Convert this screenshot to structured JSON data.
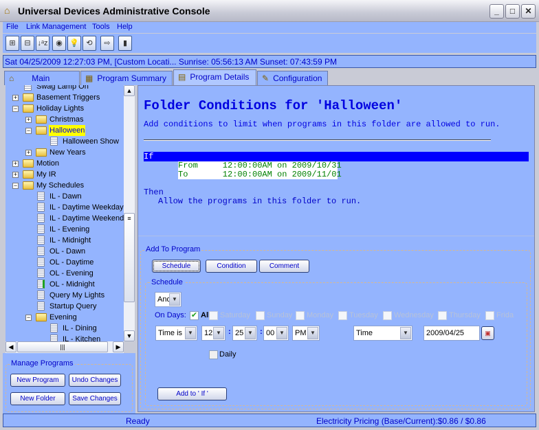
{
  "window": {
    "title": "Universal Devices Administrative Console",
    "minimize": "_",
    "maximize": "□",
    "close": "✕"
  },
  "menu": [
    "File",
    "Link Management",
    "Tools",
    "Help"
  ],
  "toolbar": [
    {
      "icon": "expand-all-icon",
      "glyph": "⊞"
    },
    {
      "icon": "collapse-all-icon",
      "glyph": "⊟"
    },
    {
      "icon": "sort-az-icon",
      "glyph": "↓ᵃz"
    },
    {
      "icon": "devices-icon",
      "glyph": "◉"
    },
    {
      "icon": "lightbulb-icon",
      "glyph": "💡"
    },
    {
      "icon": "refresh-icon",
      "glyph": "⟲"
    },
    {
      "icon": "export-icon",
      "glyph": "⇨"
    },
    {
      "icon": "chart-icon",
      "glyph": "▮"
    }
  ],
  "dateline": "Sat 04/25/2009 12:27:03 PM,  [Custom Locati... Sunrise: 05:56:13 AM   Sunset: 07:43:59 PM",
  "tabs": [
    {
      "label": "Main",
      "icon": "home-icon"
    },
    {
      "label": "Program Summary",
      "icon": "table-icon"
    },
    {
      "label": "Program Details",
      "icon": "document-icon",
      "active": true
    },
    {
      "label": "Configuration",
      "icon": "wrench-icon"
    }
  ],
  "tree": [
    {
      "label": "Swag Lamp On",
      "level": 0,
      "type": "program"
    },
    {
      "label": "Basement Triggers",
      "level": 0,
      "type": "folder",
      "toggle": "+"
    },
    {
      "label": "Holiday Lights",
      "level": 0,
      "type": "folder",
      "toggle": "-"
    },
    {
      "label": "Christmas",
      "level": 1,
      "type": "folder",
      "toggle": "+"
    },
    {
      "label": "Halloween",
      "level": 1,
      "type": "folder",
      "toggle": "-",
      "selected": true
    },
    {
      "label": "Halloween Show",
      "level": 2,
      "type": "program"
    },
    {
      "label": "New Years",
      "level": 1,
      "type": "folder",
      "toggle": "+"
    },
    {
      "label": "Motion",
      "level": 0,
      "type": "folder",
      "toggle": "+"
    },
    {
      "label": "My IR",
      "level": 0,
      "type": "folder",
      "toggle": "+"
    },
    {
      "label": "My Schedules",
      "level": 0,
      "type": "folder",
      "toggle": "-"
    },
    {
      "label": "IL - Dawn",
      "level": 1,
      "type": "program"
    },
    {
      "label": "IL - Daytime Weekdays",
      "level": 1,
      "type": "program"
    },
    {
      "label": "IL - Daytime Weekends",
      "level": 1,
      "type": "program"
    },
    {
      "label": "IL - Evening",
      "level": 1,
      "type": "program"
    },
    {
      "label": "IL - Midnight",
      "level": 1,
      "type": "program"
    },
    {
      "label": "OL - Dawn",
      "level": 1,
      "type": "program"
    },
    {
      "label": "OL - Daytime",
      "level": 1,
      "type": "program"
    },
    {
      "label": "OL - Evening",
      "level": 1,
      "type": "program"
    },
    {
      "label": "OL - Midnight",
      "level": 1,
      "type": "program",
      "running": true
    },
    {
      "label": "Query My Lights",
      "level": 1,
      "type": "program"
    },
    {
      "label": "Startup Query",
      "level": 1,
      "type": "program"
    },
    {
      "label": "Evening",
      "level": 1,
      "type": "folder",
      "toggle": "-"
    },
    {
      "label": "IL - Dining",
      "level": 2,
      "type": "program"
    },
    {
      "label": "IL - Kitchen",
      "level": 2,
      "type": "program"
    }
  ],
  "manage": {
    "title": "Manage Programs",
    "new_program": "New Program",
    "undo": "Undo Changes",
    "new_folder": "New Folder",
    "save": "Save Changes"
  },
  "details": {
    "heading": "Folder Conditions for 'Halloween'",
    "subtitle": "Add conditions to limit when programs in this folder are allowed to run.",
    "if": "If",
    "from": "From     12:00:00AM on 2009/10/31",
    "to": "To       12:00:00AM on 2009/11/01",
    "then": "Then",
    "then_action": "Allow the programs in this folder to run."
  },
  "add": {
    "title": "Add To Program",
    "schedule_btn": "Schedule",
    "condition_btn": "Condition",
    "comment_btn": "Comment",
    "schedule_title": "Schedule",
    "logic": "And",
    "on_days": "On Days:",
    "all": "All",
    "all_checked": true,
    "days": [
      "Saturday",
      "Sunday",
      "Monday",
      "Tuesday",
      "Wednesday",
      "Thursday",
      "Frida"
    ],
    "time_mode": "Time is",
    "hour": "12",
    "minute": "25",
    "second": "00",
    "ampm": "PM",
    "colon": ":",
    "type": "Time",
    "date": "2009/04/25",
    "daily": "Daily",
    "add_if": "Add to ' If '"
  },
  "status": {
    "left": "Ready",
    "right": "Electricity Pricing (Base/Current):$0.86 / $0.86"
  },
  "colors": {
    "background": "#94b4fe",
    "text": "#0000c8",
    "if_bar": "#0000ff",
    "condition": "#008000",
    "selected": "#ffff00"
  }
}
